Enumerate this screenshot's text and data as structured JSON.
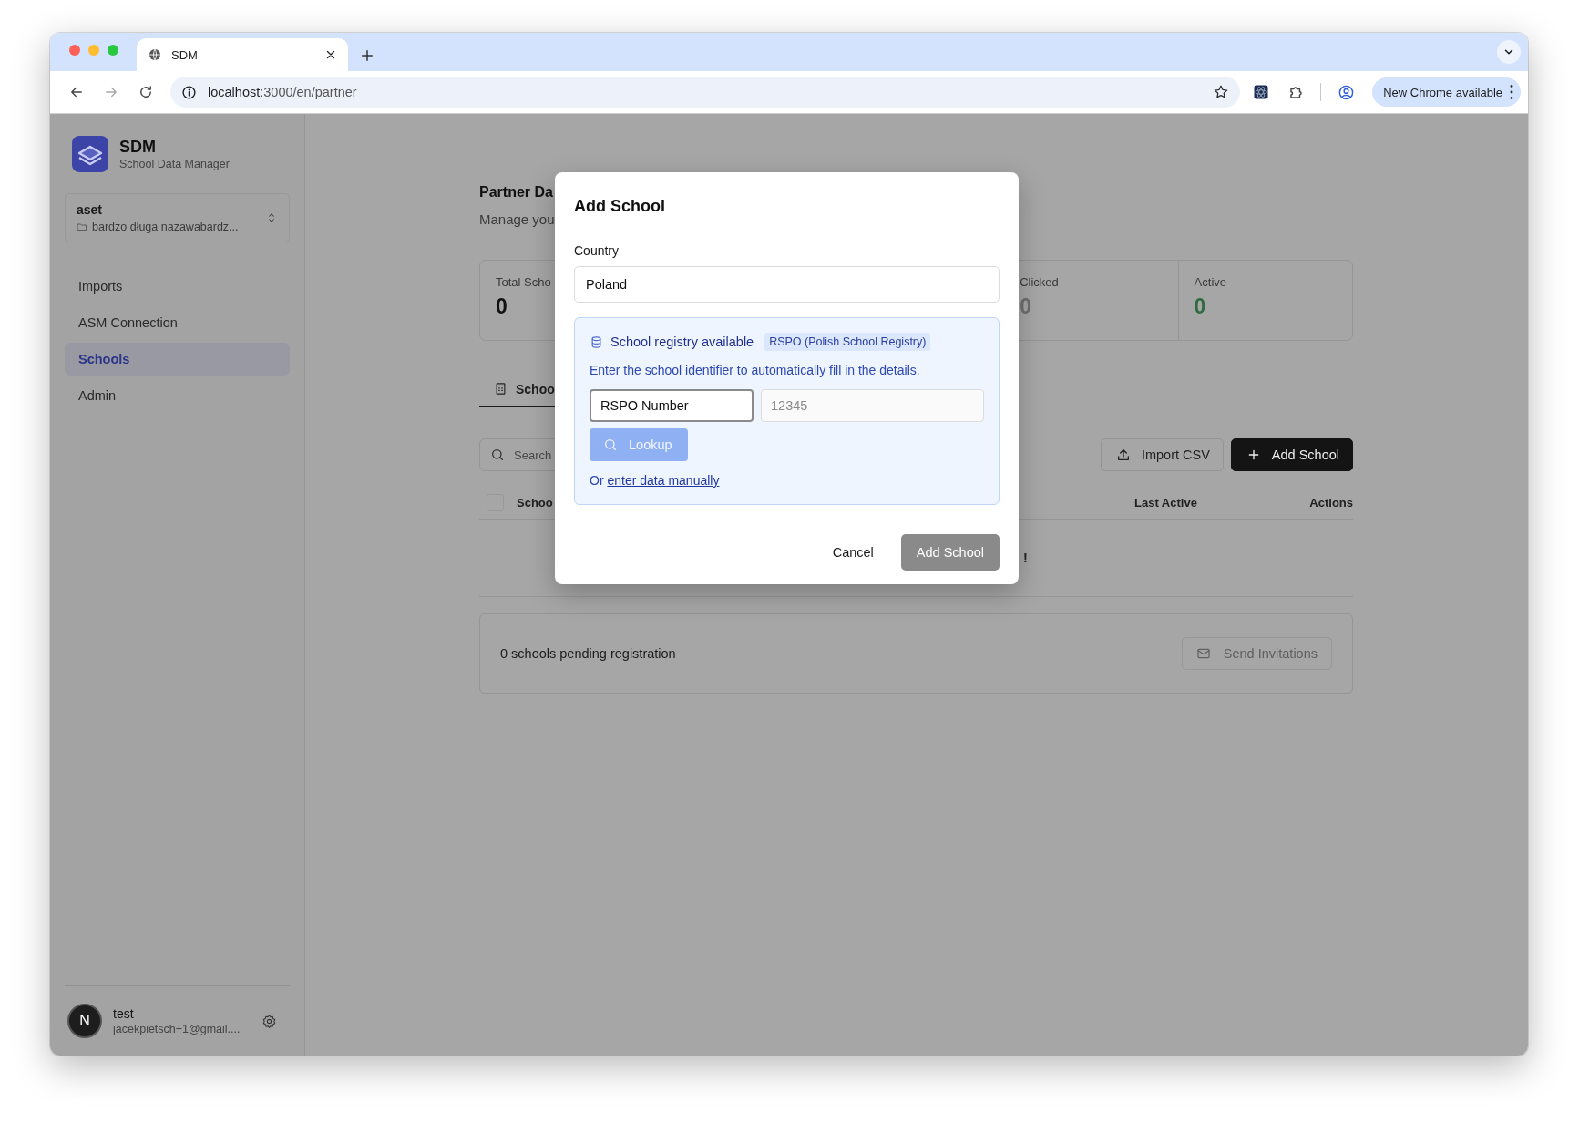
{
  "browser": {
    "tabs": [
      {
        "title": "SDM",
        "selected": true
      }
    ],
    "url_host": "localhost",
    "url_path": ":3000/en/partner",
    "update_button": "New Chrome available"
  },
  "sidebar": {
    "app_name": "SDM",
    "app_subtitle": "School Data Manager",
    "workspace": {
      "name": "aset",
      "folder": "bardzo długa nazawabardz..."
    },
    "nav": [
      {
        "label": "Imports",
        "selected": false
      },
      {
        "label": "ASM Connection",
        "selected": false
      },
      {
        "label": "Schools",
        "selected": true
      },
      {
        "label": "Admin",
        "selected": false
      }
    ],
    "user": {
      "avatar_letter": "N",
      "name": "test",
      "email": "jacekpietsch+1@gmail...."
    }
  },
  "page": {
    "title": "Partner Da",
    "subtitle": "Manage you",
    "stats": [
      {
        "label": "Total Scho",
        "value": "0",
        "color": "#111111"
      },
      {
        "label": "Clicked",
        "value": "0",
        "color": "#6e6e6e"
      },
      {
        "label": "Active",
        "value": "0",
        "color": "#2f6b3f"
      }
    ],
    "tabs": [
      {
        "label": "Schoo",
        "selected": true
      }
    ],
    "search": {
      "placeholder": "Search"
    },
    "buttons": [
      {
        "label": "Import CSV",
        "kind": "outline"
      },
      {
        "label": "Add School",
        "kind": "primary"
      }
    ],
    "table": {
      "select_all_checked": false,
      "columns": [
        "Schoo",
        "Last Active",
        "Actions"
      ],
      "empty_message": "!"
    },
    "pending": {
      "text": "0 schools pending registration",
      "button": {
        "label": "Send Invitations",
        "disabled": true
      }
    }
  },
  "dialog": {
    "title": "Add School",
    "country_label": "Country",
    "country": "Poland",
    "registry": {
      "title": "School registry available",
      "badge": "RSPO (Polish School Registry)",
      "description": "Enter the school identifier to automatically fill in the details.",
      "id_type": "RSPO Number",
      "id_placeholder": "12345",
      "lookup": {
        "label": "Lookup",
        "disabled": true
      },
      "manual_prefix": "Or",
      "manual_link": "enter data manually"
    },
    "cancel": "Cancel",
    "submit": {
      "label": "Add School",
      "disabled": true
    }
  }
}
